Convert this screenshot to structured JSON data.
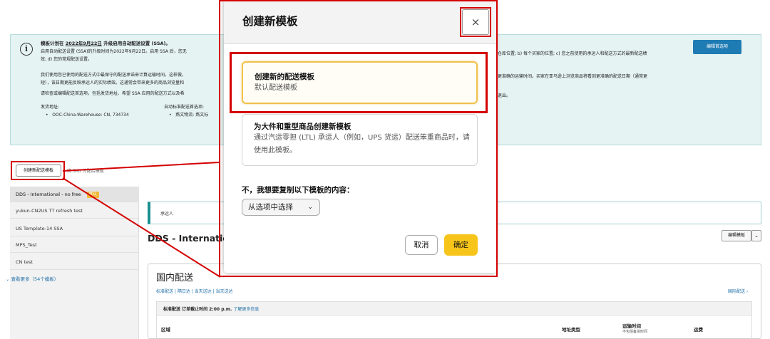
{
  "banner": {
    "icon": "info-icon",
    "title_prefix": "模板计划在",
    "title_date": "2022年9月22日",
    "title_suffix": "升级启用自动配送设置 (SSA)。",
    "line1": "启用自动配送设置 (SSA)的升级时间为2022年9月22日。启用 SSA 后，您无",
    "line1_right": "仓库位置; b) 每个买家的位置; c) 您之前使用的承运人和配送方式的最新配送绩",
    "line2": "效; d) 您的常规配送设置。",
    "line3": "我们使用您已使用的配送方式中最保守的配送承诺来计算运输时间。这样做，",
    "line3_right": "更准确的运输时间。买家在亚马逊上浏览商品将看到更准确的配送日期（通常更",
    "line4": "短），该日期更能反映承运人的实际绩效。这通常会带来更多的商品浏览量和",
    "line5": "请检查或编辑配送首选项，包括发货地址、希望 SSA 应用的配送方式以及希",
    "line5_right": "退出。",
    "ship_from_label": "发货地址:",
    "ship_from_value": "OOC-China-Warehouse: CN, 734734",
    "auto_prefs_label": "自动标准配送首选项:",
    "auto_prefs_value": "燕文物流: 燕文标",
    "edit_prefs_button": "编辑首选项"
  },
  "actions": {
    "create_button": "创建新配送模板",
    "sku_link": "将 SKU 分配给模板"
  },
  "sidebar": {
    "items": [
      {
        "label": "DDS - International - no free",
        "badge": "默认"
      },
      {
        "label": "yukun-CN2US TT refresh test"
      },
      {
        "label": "US Template-14 SSA"
      },
      {
        "label": "MPS_Test"
      },
      {
        "label": "CN test"
      }
    ],
    "more": "⌄ 查看更多（54个模板）"
  },
  "main": {
    "notice": "承运人",
    "template_title": "DDS - Internatio",
    "edit_template_button": "编辑模板",
    "domestic": {
      "title": "国内配送",
      "links": "标准配送 | 隔日达 | 当天送达 | 当天送达",
      "international_link": "国际配送 ›",
      "standard_row_label": "标准配送 订单截止时间 2:00 p.m.",
      "learn_more": "了解更多信息",
      "headers": {
        "region": "区域",
        "address_type": "地址类型",
        "transit_time": "运输时间",
        "transit_note": "不包括备货时间",
        "shipping_fee": "运费"
      }
    }
  },
  "modal": {
    "title": "创建新模板",
    "close_glyph": "×",
    "option1": {
      "title": "创建新的配送模板",
      "desc": "默认配送模板"
    },
    "option2": {
      "title": "为大件和重型商品创建新模板",
      "desc": "通过汽运零担 (LTL) 承运人（例如，UPS 货运）配送笨重商品时，请使用此模板。"
    },
    "copy_label": "不，我想要复制以下模板的内容：",
    "select_value": "从选项中选择",
    "cancel": "取消",
    "ok": "确定"
  },
  "colors": {
    "highlight": "#d40000",
    "accent_yellow": "#f7c51a",
    "banner_bg": "#e6f3f3",
    "link_blue": "#1f6fa8"
  }
}
